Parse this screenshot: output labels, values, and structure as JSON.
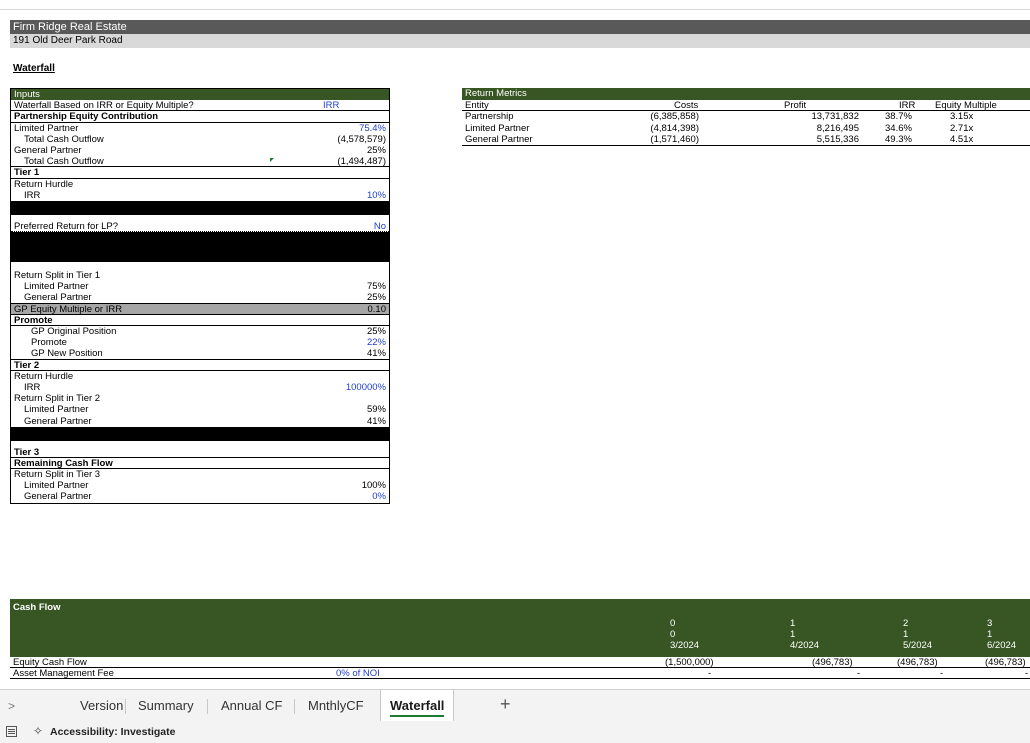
{
  "company": "Firm Ridge Real Estate",
  "address": "191 Old Deer Park Road",
  "section_title": "Waterfall",
  "inputs": {
    "header": "Inputs",
    "waterfall_label": "Waterfall Based on IRR or Equity Multiple?",
    "waterfall_value": "IRR",
    "pec_label": "Partnership Equity Contribution",
    "lp_label": "Limited Partner",
    "lp_value": "75.4%",
    "lp_tco_label": "Total Cash Outflow",
    "lp_tco_value": "(4,578,579)",
    "gp_label": "General Partner",
    "gp_value": "25%",
    "gp_tco_label": "Total Cash Outflow",
    "gp_tco_value": "(1,494,487)",
    "tier1": "Tier 1",
    "return_hurdle": "Return Hurdle",
    "irr_label": "IRR",
    "tier1_irr": "10%",
    "pref_label": "Preferred Return for LP?",
    "pref_value": "No",
    "split1_label": "Return Split in Tier 1",
    "split1_lp_label": "Limited Partner",
    "split1_lp": "75%",
    "split1_gp_label": "General Partner",
    "split1_gp": "25%",
    "gp_em_label": "GP Equity Multiple or IRR",
    "gp_em_value": "0.10",
    "promote_header": "Promote",
    "gp_orig_label": "GP Original Position",
    "gp_orig": "25%",
    "promote_label": "Promote",
    "promote": "22%",
    "gp_new_label": "GP New Position",
    "gp_new": "41%",
    "tier2": "Tier 2",
    "return_hurdle2": "Return Hurdle",
    "irr2_label": "IRR",
    "tier2_irr": "100000%",
    "split2_label": "Return Split in Tier 2",
    "split2_lp_label": "Limited Partner",
    "split2_lp": "59%",
    "split2_gp_label": "General Partner",
    "split2_gp": "41%",
    "tier3": "Tier 3",
    "remaining_cf": "Remaining Cash Flow",
    "split3_label": "Return Split in Tier 3",
    "split3_lp_label": "Limited Partner",
    "split3_lp": "100%",
    "split3_gp_label": "General Partner",
    "split3_gp": "0%"
  },
  "metrics": {
    "header": "Return Metrics",
    "columns": [
      "Entity",
      "Costs",
      "Profit",
      "IRR",
      "Equity Multiple"
    ],
    "rows": [
      [
        "Partnership",
        "(6,385,858)",
        "13,731,832",
        "38.7%",
        "3.15x"
      ],
      [
        "Limited Partner",
        "(4,814,398)",
        "8,216,495",
        "34.6%",
        "2.71x"
      ],
      [
        "General Partner",
        "(1,571,460)",
        "5,515,336",
        "49.3%",
        "4.51x"
      ]
    ]
  },
  "cashflow": {
    "header": "Cash Flow",
    "periods": [
      {
        "n": "0",
        "m": "0",
        "date": "3/2024"
      },
      {
        "n": "1",
        "m": "1",
        "date": "4/2024"
      },
      {
        "n": "2",
        "m": "1",
        "date": "5/2024"
      },
      {
        "n": "3",
        "m": "1",
        "date": "6/2024"
      }
    ],
    "equity_label": "Equity Cash Flow",
    "equity_values": [
      "(1,500,000)",
      "(496,783)",
      "(496,783)",
      "(496,783)"
    ],
    "amf_label": "Asset Management Fee",
    "amf_note": "0% of NOI",
    "amf_values": [
      "-",
      "-",
      "-",
      "-"
    ]
  },
  "tabs": [
    "Version",
    "Summary",
    "Annual CF",
    "MnthlyCF",
    "Waterfall"
  ],
  "active_tab": "Waterfall",
  "status": "Accessibility: Investigate",
  "colors": {
    "header_green": "#375623",
    "input_blue": "#1f3fcc",
    "title_grey": "#595959"
  }
}
